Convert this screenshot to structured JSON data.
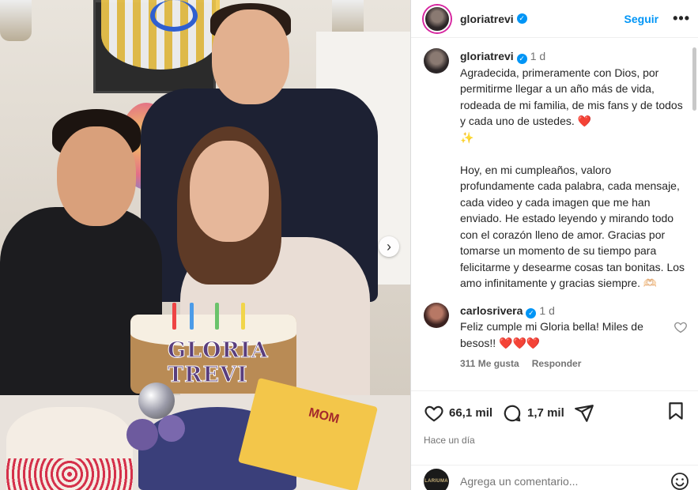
{
  "post": {
    "username": "gloriatrevi",
    "follow_label": "Seguir",
    "more_label": "•••",
    "time_ago": "1 d",
    "caption_p1": "Agradecida, primeramente con Dios, por permitirme llegar a un año más de vida, rodeada de mi familia, de mis fans y de todos y cada uno de ustedes.",
    "caption_p2": "Hoy, en mi cumpleaños, valoro profundamente cada palabra, cada mensaje, cada video y cada imagen que me han enviado. He estado leyendo y mirando todo con el corazón lleno de amor. Gracias por tomarse un momento de su tiempo para felicitarme y desearme cosas tan bonitas. Los amo infinitamente y gracias siempre. 🫶🏻",
    "heart_emoji": "❤️",
    "sparkle_emoji": "✨"
  },
  "photo": {
    "cake_text": "GLORIA TREVI",
    "card_text": "MOM",
    "next_icon": "›"
  },
  "comment": {
    "username": "carlosrivera",
    "time_ago": "1 d",
    "text": "Feliz cumple mi Gloria bella! Miles de besos!!",
    "hearts": "❤️❤️❤️",
    "likes": "311 Me gusta",
    "reply_label": "Responder"
  },
  "actions": {
    "likes_count": "66,1 mil",
    "comments_count": "1,7 mil",
    "posted_ago": "Hace un día"
  },
  "add_comment": {
    "placeholder": "Agrega un comentario..."
  },
  "my_avatar_text": "LARIUMA",
  "colors": {
    "link_blue": "#0095f6",
    "verified_blue": "#0095f6",
    "muted_gray": "#737373",
    "border": "#dbdbdb"
  },
  "icons": [
    "verified-icon",
    "more-icon",
    "heart-icon",
    "comment-icon",
    "share-icon",
    "bookmark-icon",
    "emoji-icon",
    "next-arrow-icon"
  ]
}
